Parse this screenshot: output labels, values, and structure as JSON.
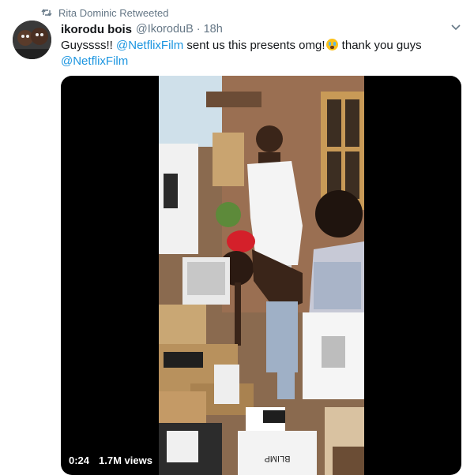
{
  "retweet": {
    "text": "Rita Dominic Retweeted"
  },
  "author": {
    "display_name": "ikorodu bois",
    "handle": "@IkoroduB",
    "time": "18h"
  },
  "tweet": {
    "text_part1": "Guyssss!! ",
    "mention1": "@NetflixFilm",
    "text_part2": " sent us this presents omg!",
    "emoji_name": "crying-face-emoji",
    "text_part3": " thank you guys",
    "mention2": "@NetflixFilm"
  },
  "video": {
    "elapsed": "0:24",
    "views": "1.7M views",
    "box_label": "BLIMP"
  },
  "icons": {
    "retweet": "retweet-icon",
    "caret": "chevron-down-icon"
  },
  "colors": {
    "link": "#1b95e0",
    "muted": "#657786",
    "text": "#14171a"
  }
}
